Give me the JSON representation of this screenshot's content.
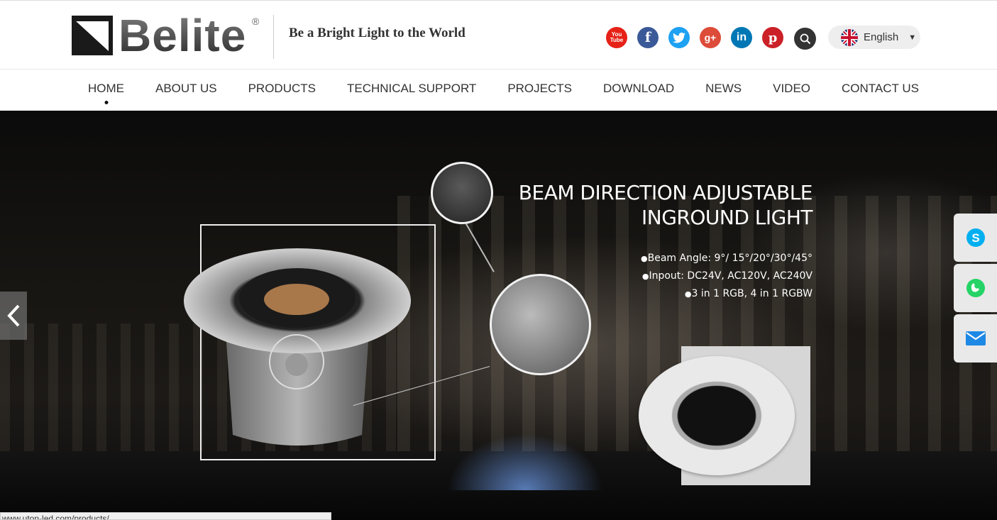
{
  "brand": {
    "name": "Belite",
    "registered": "®",
    "slogan": "Be a Bright Light to the World"
  },
  "social": [
    {
      "name": "youtube",
      "label": "You Tube",
      "color": "#e62117"
    },
    {
      "name": "facebook",
      "label": "f",
      "color": "#3b5998"
    },
    {
      "name": "twitter",
      "label": "t",
      "color": "#1da1f2"
    },
    {
      "name": "google-plus",
      "label": "g+",
      "color": "#dd4b39"
    },
    {
      "name": "linkedin",
      "label": "in",
      "color": "#0077b5"
    },
    {
      "name": "pinterest",
      "label": "p",
      "color": "#cb2027"
    }
  ],
  "language": {
    "selected": "English"
  },
  "nav": {
    "items": [
      {
        "label": "HOME",
        "active": true
      },
      {
        "label": "ABOUT US"
      },
      {
        "label": "PRODUCTS"
      },
      {
        "label": "TECHNICAL SUPPORT"
      },
      {
        "label": "PROJECTS"
      },
      {
        "label": "DOWNLOAD"
      },
      {
        "label": "NEWS"
      },
      {
        "label": "VIDEO"
      },
      {
        "label": "CONTACT US"
      }
    ]
  },
  "banner": {
    "title_line1": "BEAM DIRECTION ADJUSTABLE",
    "title_line2": "INGROUND LIGHT",
    "specs": [
      "Beam Angle: 9°/ 15°/20°/30°/45°",
      "Inpout: DC24V, AC120V, AC240V",
      "3 in 1 RGB, 4 in 1 RGBW"
    ]
  },
  "side_contacts": [
    "skype",
    "whatsapp",
    "email"
  ],
  "status_url": "www.uton-led.com/products/"
}
